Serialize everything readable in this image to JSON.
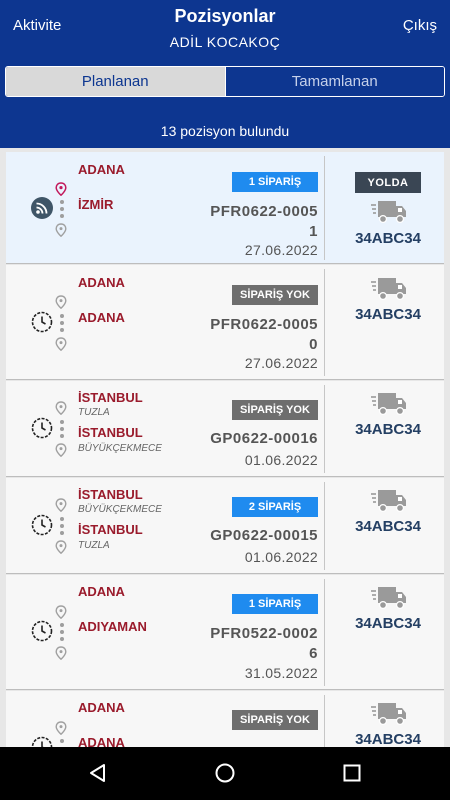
{
  "header": {
    "left_label": "Aktivite",
    "title": "Pozisyonlar",
    "subtitle": "ADİL  KOCAKOÇ",
    "right_label": "Çıkış"
  },
  "tabs": [
    {
      "label": "Planlanan",
      "active": true
    },
    {
      "label": "Tamamlanan",
      "active": false
    }
  ],
  "result_count": "13 pozisyon bulundu",
  "colors": {
    "header_bg": "#0d3690",
    "city": "#9a1b2c",
    "badge_blue": "#1f8bef",
    "badge_gray": "#6e6e6e",
    "plate": "#243f63"
  },
  "positions": [
    {
      "status_icon": "rss-icon",
      "from_city": "ADANA",
      "from_district": "",
      "to_city": "İZMİR",
      "to_district": "",
      "order_badge": "1 SİPARİŞ",
      "badge_style": "blue",
      "code_line1": "PFR0622-0005",
      "code_line2": "1",
      "date": "27.06.2022",
      "vehicle_status": "YOLDA",
      "plate": "34ABC34"
    },
    {
      "status_icon": "clock-icon",
      "from_city": "ADANA",
      "from_district": "",
      "to_city": "ADANA",
      "to_district": "",
      "order_badge": "SİPARİŞ YOK",
      "badge_style": "gray",
      "code_line1": "PFR0622-0005",
      "code_line2": "0",
      "date": "27.06.2022",
      "vehicle_status": "",
      "plate": "34ABC34"
    },
    {
      "status_icon": "clock-icon",
      "from_city": "İSTANBUL",
      "from_district": "TUZLA",
      "to_city": "İSTANBUL",
      "to_district": "BÜYÜKÇEKMECE",
      "order_badge": "SİPARİŞ YOK",
      "badge_style": "gray",
      "code_line1": "GP0622-00016",
      "code_line2": "",
      "date": "01.06.2022",
      "vehicle_status": "",
      "plate": "34ABC34"
    },
    {
      "status_icon": "clock-icon",
      "from_city": "İSTANBUL",
      "from_district": "BÜYÜKÇEKMECE",
      "to_city": "İSTANBUL",
      "to_district": "TUZLA",
      "order_badge": "2 SİPARİŞ",
      "badge_style": "blue",
      "code_line1": "GP0622-00015",
      "code_line2": "",
      "date": "01.06.2022",
      "vehicle_status": "",
      "plate": "34ABC34"
    },
    {
      "status_icon": "clock-icon",
      "from_city": "ADANA",
      "from_district": "",
      "to_city": "ADIYAMAN",
      "to_district": "",
      "order_badge": "1 SİPARİŞ",
      "badge_style": "blue",
      "code_line1": "PFR0522-0002",
      "code_line2": "6",
      "date": "31.05.2022",
      "vehicle_status": "",
      "plate": "34ABC34"
    },
    {
      "status_icon": "clock-icon",
      "from_city": "ADANA",
      "from_district": "",
      "to_city": "ADANA",
      "to_district": "",
      "order_badge": "SİPARİŞ YOK",
      "badge_style": "gray",
      "code_line1": "",
      "code_line2": "",
      "date": "",
      "vehicle_status": "",
      "plate": "34ABC34"
    }
  ],
  "navbar": {
    "icons": [
      "back-icon",
      "home-icon",
      "recents-icon"
    ]
  }
}
